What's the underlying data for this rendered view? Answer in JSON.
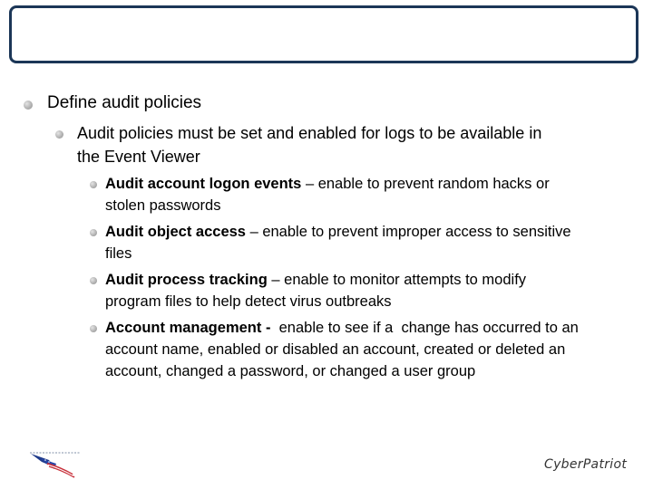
{
  "slide": {
    "title": "",
    "level1": [
      {
        "text": "Define audit policies",
        "level2": [
          {
            "lines": [
              "Audit policies must be set and enabled for logs to be available in",
              "the Event Viewer"
            ],
            "level3": [
              {
                "bold": "Audit account logon events",
                "lines": [
                  " – enable to prevent random hacks or",
                  "stolen passwords"
                ]
              },
              {
                "bold": "Audit object access",
                "lines": [
                  " – enable to prevent improper access to sensitive",
                  "files"
                ]
              },
              {
                "bold": "Audit process tracking",
                "lines": [
                  " – enable to monitor attempts to modify",
                  "program files to help detect virus outbreaks"
                ]
              },
              {
                "bold": "Account management -",
                "lines": [
                  "  enable to see if a  change has occurred to an",
                  "account name, enabled or disabled an account, created or deleted an",
                  "account, changed a password, or changed a user group"
                ]
              }
            ]
          }
        ]
      }
    ]
  },
  "footer": {
    "logo_icon": "flag-swoosh-logo",
    "brand": "CyberPatriot"
  },
  "colors": {
    "title_border": "#1b3657",
    "bullet": "#b3b3b3"
  }
}
